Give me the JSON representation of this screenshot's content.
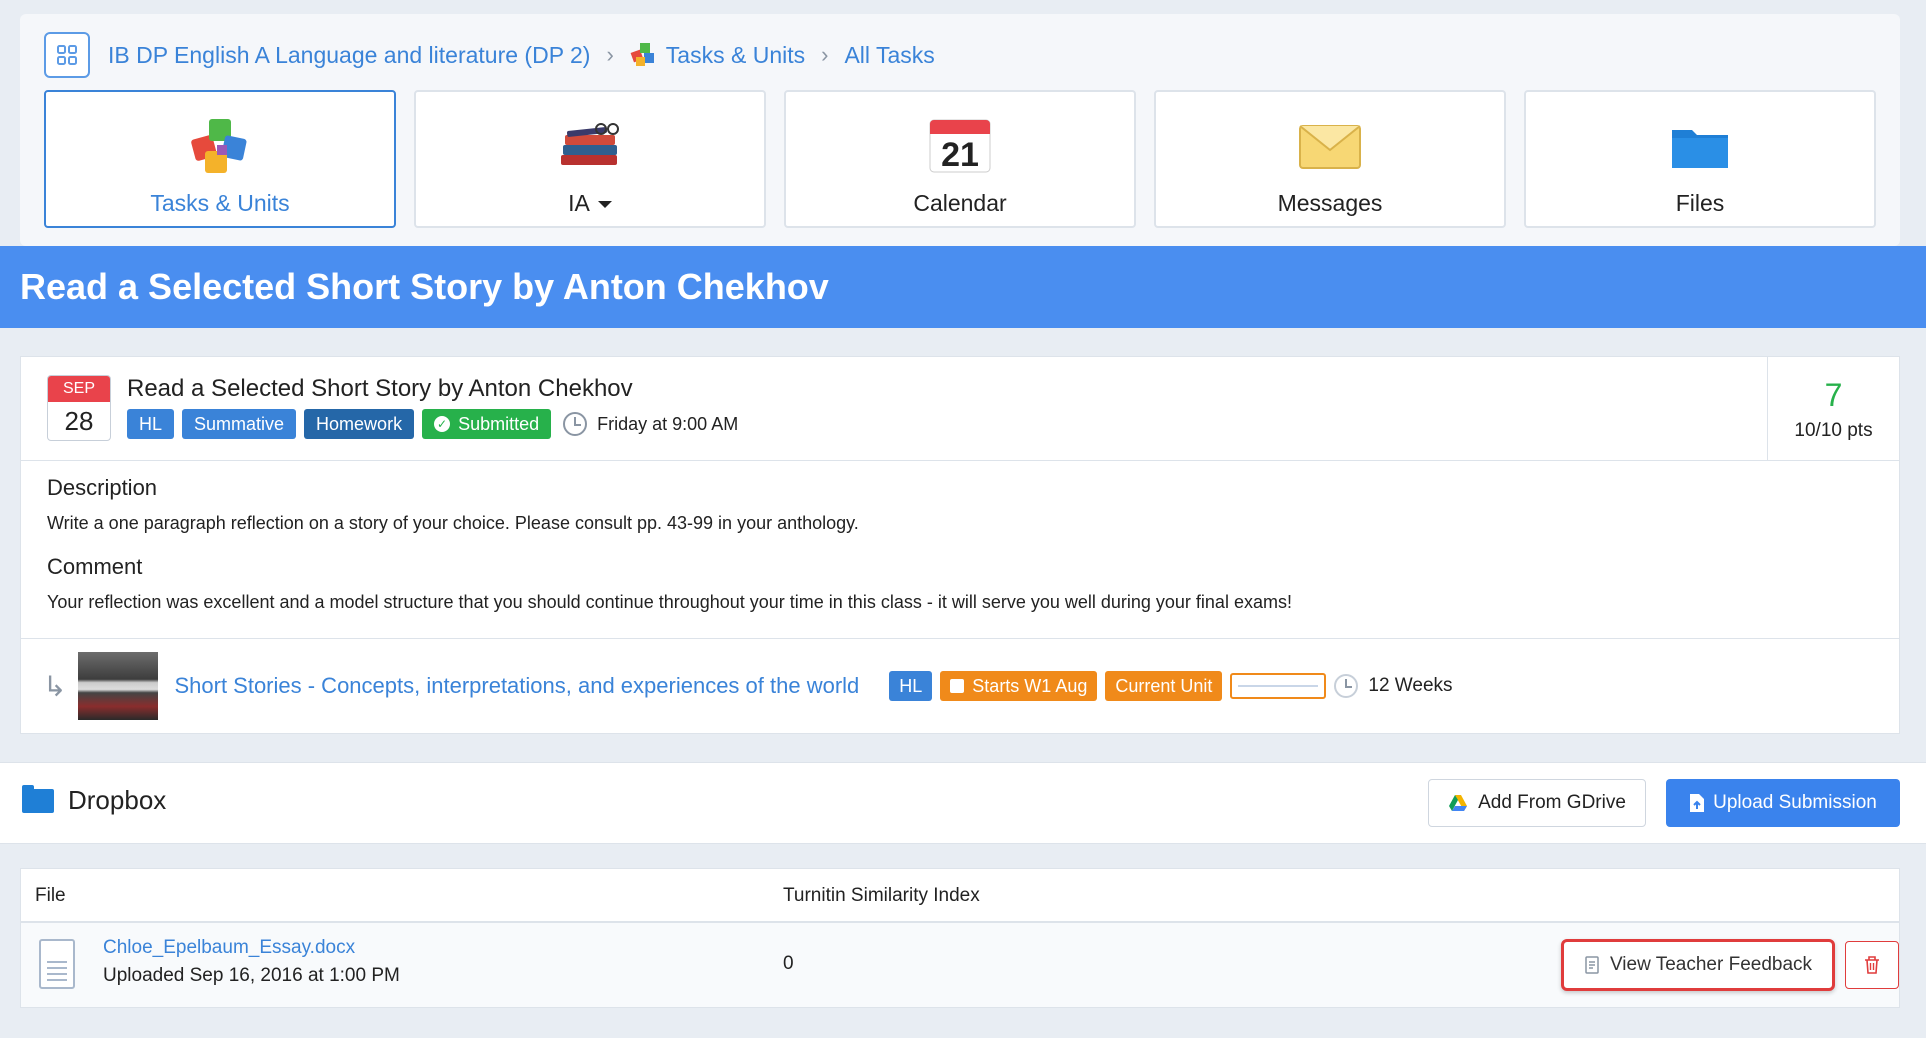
{
  "breadcrumb": {
    "course": "IB DP English A Language and literature (DP 2)",
    "section": "Tasks & Units",
    "page": "All Tasks"
  },
  "tiles": [
    {
      "label": "Tasks & Units",
      "icon": "puzzle-icon",
      "active": true
    },
    {
      "label": "IA",
      "icon": "books-icon",
      "dropdown": true
    },
    {
      "label": "Calendar",
      "icon": "calendar-icon",
      "day": "21"
    },
    {
      "label": "Messages",
      "icon": "envelope-icon"
    },
    {
      "label": "Files",
      "icon": "folder-icon"
    }
  ],
  "banner": {
    "title": "Read a Selected Short Story by Anton Chekhov"
  },
  "task": {
    "month": "SEP",
    "day": "28",
    "title": "Read a Selected Short Story by Anton Chekhov",
    "tags": [
      "HL",
      "Summative",
      "Homework",
      "Submitted"
    ],
    "due": "Friday at 9:00 AM",
    "score": "7",
    "points": "10/10 pts",
    "description_heading": "Description",
    "description": "Write a one paragraph reflection on a story of your choice. Please consult pp. 43-99 in your anthology.",
    "comment_heading": "Comment",
    "comment": "Your reflection was excellent and a model structure that you should continue throughout your time in this class - it will serve you well during your final exams!"
  },
  "unit": {
    "title": "Short Stories - Concepts, interpretations, and experiences of the world",
    "level": "HL",
    "start": "Starts W1 Aug",
    "status": "Current Unit",
    "duration": "12 Weeks"
  },
  "dropbox": {
    "title": "Dropbox",
    "gdrive_label": "Add From GDrive",
    "upload_label": "Upload Submission",
    "columns": [
      "File",
      "Turnitin Similarity Index"
    ],
    "files": [
      {
        "name": "Chloe_Epelbaum_Essay.docx",
        "uploaded": "Uploaded Sep 16, 2016 at 1:00 PM",
        "turnitin": "0"
      }
    ],
    "feedback_label": "View Teacher Feedback"
  },
  "colors": {
    "accent": "#4a8ef0",
    "success": "#27b14b",
    "warning": "#f08a1a",
    "danger": "#e03c3c"
  }
}
